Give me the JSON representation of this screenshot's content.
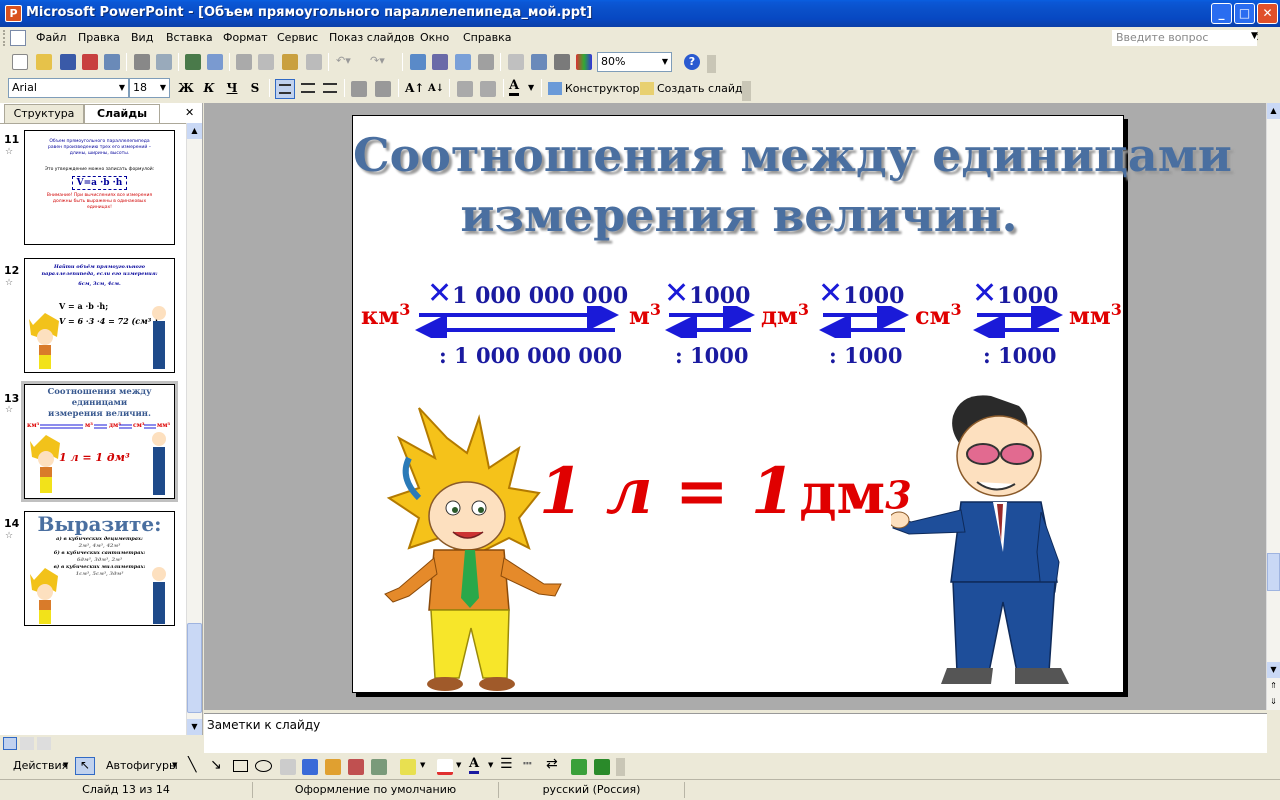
{
  "window": {
    "title": "Microsoft PowerPoint - [Объем прямоугольного параллелепипеда_мой.ppt]",
    "min": "_",
    "max": "□",
    "close": "✕"
  },
  "menu": [
    "Файл",
    "Правка",
    "Вид",
    "Вставка",
    "Формат",
    "Сервис",
    "Показ слайдов",
    "Окно",
    "Справка"
  ],
  "question_placeholder": "Введите вопрос",
  "toolbar": {
    "zoom": "80%",
    "help": "?"
  },
  "format_toolbar": {
    "font": "Arial",
    "size": "18",
    "bold": "Ж",
    "italic": "К",
    "underline": "Ч",
    "shadow": "S",
    "designer": "Конструктор",
    "new_slide": "Создать слайд"
  },
  "pane_tabs": {
    "structure": "Структура",
    "slides": "Слайды"
  },
  "thumbnails": [
    {
      "num": "11",
      "lines": [
        "Объем прямоугольного параллелепипеда",
        "равен произведению трех его измерений –",
        "длины, ширины, высоты.",
        "Это утверждение можно записать формулой:",
        "V=a  ·b  ·h",
        "Внимание! При вычислениях все измерения",
        "должны быть выражены в одинаковых",
        "единицах!"
      ]
    },
    {
      "num": "12",
      "lines": [
        "Найти объём прямоугольного",
        "параллелепипеда, если его измерения:",
        "6см, 3см, 4см.",
        "V = a  ·b  ·h;",
        "V = 6  ·3  ·4 = 72 (см³ )"
      ]
    },
    {
      "num": "13",
      "lines": [
        "Соотношения между единицами",
        "измерения величин.",
        "1 л = 1 дм³"
      ]
    },
    {
      "num": "14",
      "lines": [
        "Выразите:",
        "а) в кубических дециметрах:",
        "2м³,   4м³,   42м³",
        "б) в кубических сантиметрах:",
        "6дм³,   3дм³,   2м³",
        "в) в кубических миллиметрах:",
        "1см³,   5см³,   3дм³"
      ]
    }
  ],
  "slide": {
    "title_line1": "Соотношения между единицами",
    "title_line2": "измерения величин.",
    "units": [
      "км",
      "м",
      "дм",
      "см",
      "мм"
    ],
    "exponent": "3",
    "multipliers": [
      "1 000 000 000",
      "1000",
      "1000",
      "1000"
    ],
    "divisors": [
      ": 1 000 000 000",
      ": 1000",
      ": 1000",
      ": 1000"
    ],
    "formula_left": "1 л = 1",
    "formula_right": "дм"
  },
  "notes_placeholder": "Заметки к слайду",
  "drawing": {
    "actions": "Действия",
    "autoshapes": "Автофигуры"
  },
  "status": {
    "slide": "Слайд 13 из 14",
    "design": "Оформление по умолчанию",
    "lang": "русский (Россия)"
  },
  "colors": {
    "title_bar": "#0A4FC8",
    "unit_red": "#E00000",
    "value_blue": "#1A1AA0",
    "arrow_blue": "#1A1AD8",
    "title_slate": "#4A6FA0"
  }
}
